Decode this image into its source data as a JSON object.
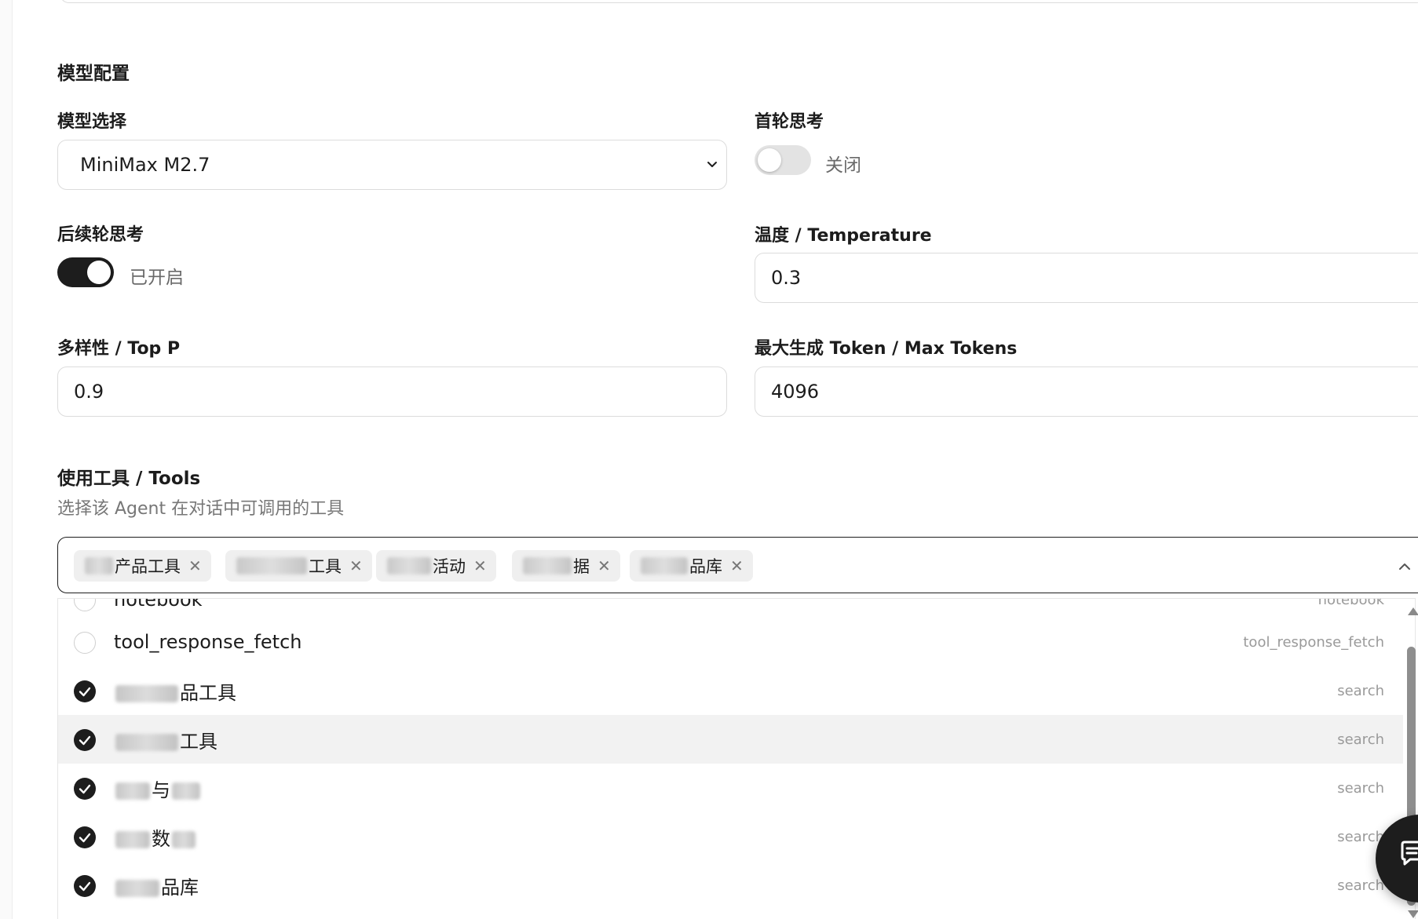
{
  "model_config": {
    "section_title": "模型配置",
    "model_select": {
      "label": "模型选择",
      "value": "MiniMax M2.7"
    },
    "first_round_thinking": {
      "label": "首轮思考",
      "state_text": "关闭",
      "enabled": false
    },
    "subsequent_thinking": {
      "label": "后续轮思考",
      "state_text": "已开启",
      "enabled": true
    },
    "temperature": {
      "label": "温度 / Temperature",
      "value": "0.3"
    },
    "top_p": {
      "label": "多样性 / Top P",
      "value": "0.9"
    },
    "max_tokens": {
      "label": "最大生成 Token / Max Tokens",
      "value": "4096"
    }
  },
  "tools": {
    "section_title": "使用工具 / Tools",
    "helper_text": "选择该 Agent 在对话中可调用的工具",
    "selected_tags": [
      {
        "visible_text": "产品工具"
      },
      {
        "visible_text": "工具"
      },
      {
        "visible_text": "活动"
      },
      {
        "visible_text": "据"
      },
      {
        "visible_text": "品库"
      }
    ],
    "options": [
      {
        "name": "notebook",
        "type": "notebook",
        "checked": false
      },
      {
        "name": "tool_response_fetch",
        "type": "tool_response_fetch",
        "checked": false
      },
      {
        "name": "品工具",
        "type": "search",
        "checked": true
      },
      {
        "name": "工具",
        "type": "search",
        "checked": true
      },
      {
        "name": "与",
        "type": "search",
        "checked": true
      },
      {
        "name": "数",
        "type": "search",
        "checked": true
      },
      {
        "name": "品库",
        "type": "search",
        "checked": true
      }
    ]
  },
  "colors": {
    "accent": "#1d1d1d",
    "toggle_off": "#e3e3e3",
    "muted_text": "#9a9a9a",
    "border": "#dcdcdc"
  },
  "icons": {
    "select_arrow": "chevron-down-icon",
    "tags_arrow": "chevron-up-icon",
    "checked": "check-circle-icon",
    "chat": "chat-icon"
  }
}
